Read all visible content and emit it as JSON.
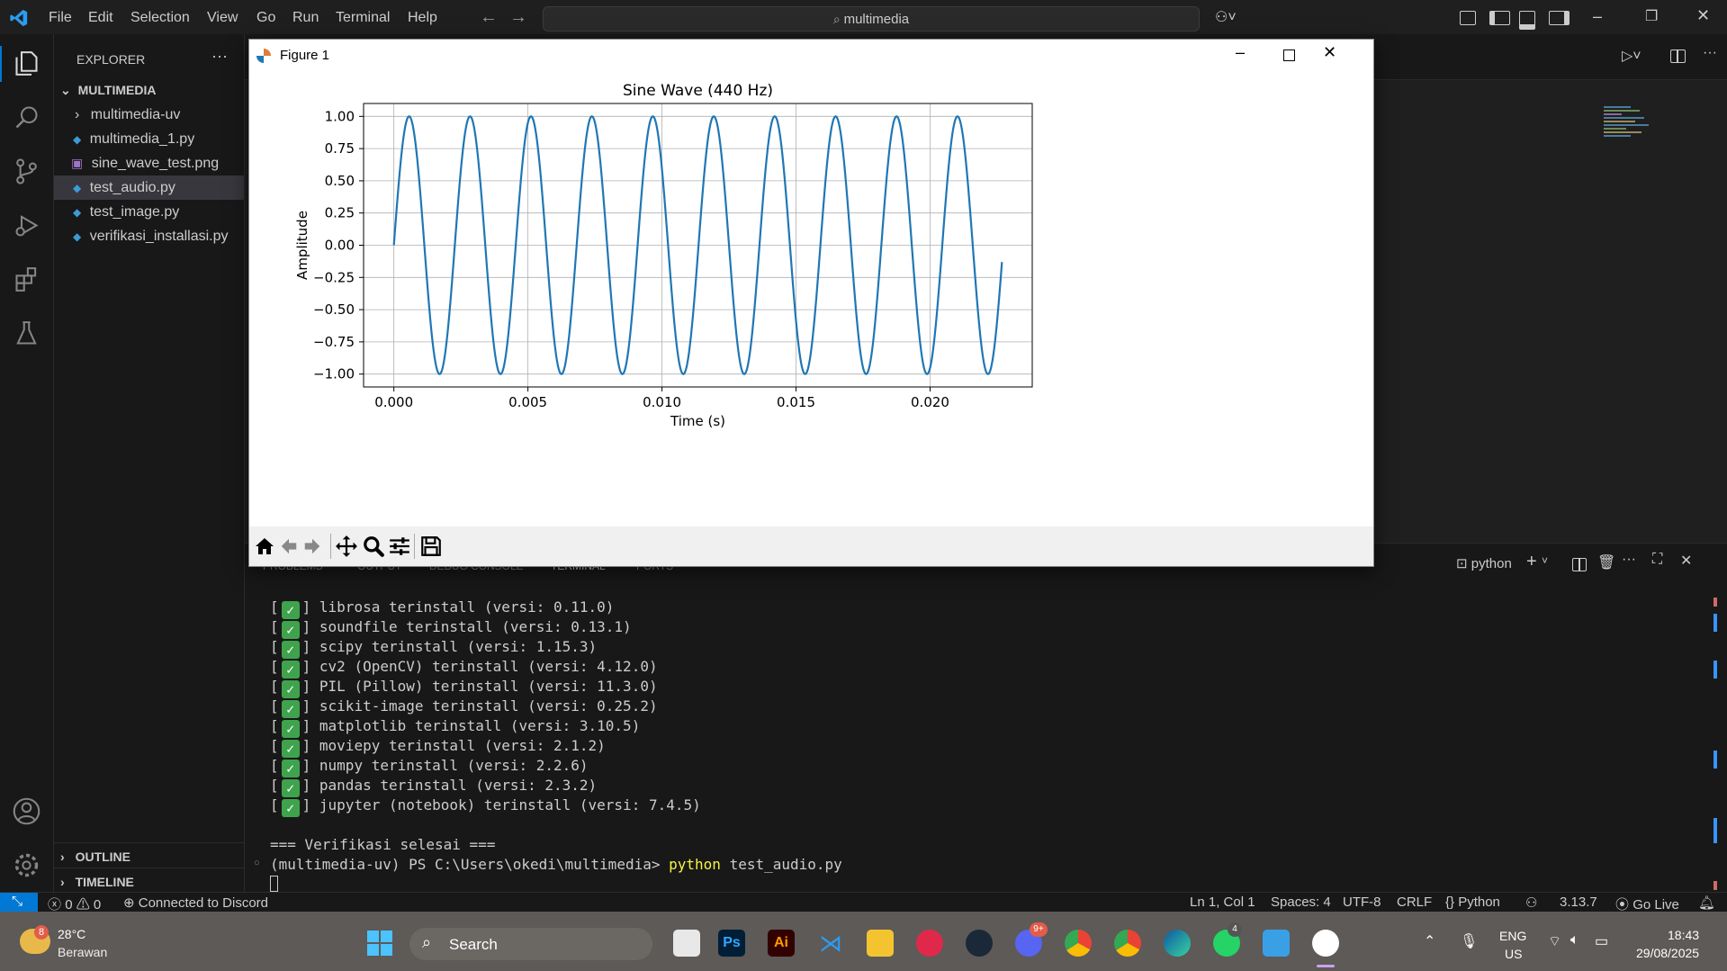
{
  "titlebar": {
    "menus": [
      "File",
      "Edit",
      "Selection",
      "View",
      "Go",
      "Run",
      "Terminal",
      "Help"
    ],
    "search_text": "multimedia"
  },
  "explorer": {
    "header": "EXPLORER",
    "more": "···",
    "folder": "MULTIMEDIA",
    "items": [
      {
        "label": "multimedia-uv",
        "icon": "chevron-right-icon"
      },
      {
        "label": "multimedia_1.py",
        "icon": "python-file-icon"
      },
      {
        "label": "sine_wave_test.png",
        "icon": "image-file-icon"
      },
      {
        "label": "test_audio.py",
        "icon": "python-file-icon"
      },
      {
        "label": "test_image.py",
        "icon": "python-file-icon"
      },
      {
        "label": "verifikasi_installasi.py",
        "icon": "python-file-icon"
      }
    ],
    "outline": "OUTLINE",
    "timeline": "TIMELINE"
  },
  "figure": {
    "window_title": "Figure 1",
    "chart_data": {
      "type": "line",
      "title": "Sine Wave (440 Hz)",
      "xlabel": "Time (s)",
      "ylabel": "Amplitude",
      "xlim": [
        -0.00113,
        0.02381
      ],
      "ylim": [
        -1.1,
        1.1
      ],
      "x_ticks": [
        0.0,
        0.005,
        0.01,
        0.015,
        0.02
      ],
      "x_tick_labels": [
        "0.000",
        "0.005",
        "0.010",
        "0.015",
        "0.020"
      ],
      "y_ticks": [
        1.0,
        0.75,
        0.5,
        0.25,
        0.0,
        -0.25,
        -0.5,
        -0.75,
        -1.0
      ],
      "y_tick_labels": [
        "1.00",
        "0.75",
        "0.50",
        "0.25",
        "0.00",
        "−0.25",
        "−0.50",
        "−0.75",
        "−1.00"
      ],
      "grid": true,
      "series": [
        {
          "frequency_hz": 440,
          "x_start": 0.0,
          "x_end": 0.02268,
          "color": "#1f77b4"
        }
      ]
    }
  },
  "panel": {
    "tabs": [
      "PROBLEMS",
      "OUTPUT",
      "DEBUG CONSOLE",
      "TERMINAL",
      "PORTS"
    ],
    "terminal_name": "python",
    "lines": [
      "librosa terinstall (versi: 0.11.0)",
      "soundfile terinstall (versi: 0.13.1)",
      "scipy terinstall (versi: 1.15.3)",
      "cv2 (OpenCV) terinstall (versi: 4.12.0)",
      "PIL (Pillow) terinstall (versi: 11.3.0)",
      "scikit-image terinstall (versi: 0.25.2)",
      "matplotlib terinstall (versi: 3.10.5)",
      "moviepy terinstall (versi: 2.1.2)",
      "numpy terinstall (versi: 2.2.6)",
      "pandas terinstall (versi: 2.3.2)",
      "jupyter (notebook) terinstall (versi: 7.4.5)"
    ],
    "done_line": "=== Verifikasi selesai ===",
    "prompt": "(multimedia-uv) PS C:\\Users\\okedi\\multimedia>",
    "command": "python",
    "command_arg": "test_audio.py"
  },
  "statusbar": {
    "errors": "0",
    "warnings": "0",
    "discord": "Connected to Discord",
    "position": "Ln 1, Col 1",
    "spaces": "Spaces: 4",
    "encoding": "UTF-8",
    "eol": "CRLF",
    "language": "Python",
    "py_version": "3.13.7",
    "golive": "Go Live"
  },
  "taskbar": {
    "weather_badge": "8",
    "temp": "28°C",
    "weather": "Berawan",
    "search": "Search",
    "lang1": "ENG",
    "lang2": "US",
    "time": "18:43",
    "date": "29/08/2025",
    "discord_badge": "9+",
    "whatsapp_badge": "4"
  },
  "colors": {
    "accent": "#0078d4",
    "line": "#1f77b4"
  }
}
